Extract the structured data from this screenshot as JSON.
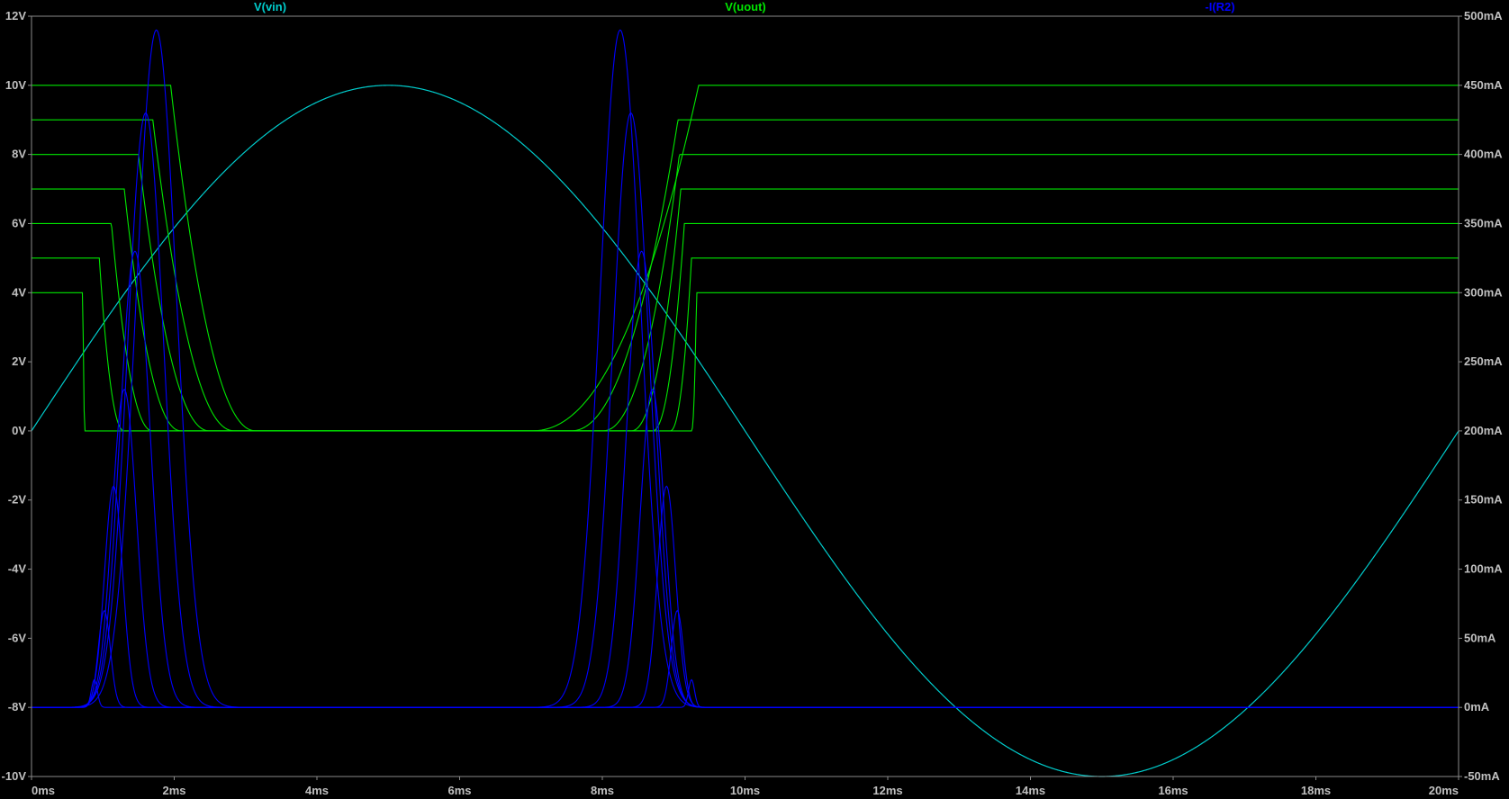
{
  "colors": {
    "background": "#000000",
    "frame": "#8a8a8a",
    "vin": "#00cccc",
    "vout": "#00e600",
    "ir2": "#0000ff",
    "label": "#c0c0c0"
  },
  "chart_data": {
    "type": "line",
    "title": "",
    "x_axis": {
      "range": [
        0,
        20
      ],
      "unit": "ms",
      "ticks": [
        0,
        2,
        4,
        6,
        8,
        10,
        12,
        14,
        16,
        18,
        20
      ],
      "tick_labels": [
        "0ms",
        "2ms",
        "4ms",
        "6ms",
        "8ms",
        "10ms",
        "12ms",
        "14ms",
        "16ms",
        "18ms",
        "20ms"
      ]
    },
    "y_left": {
      "range": [
        -10,
        12
      ],
      "unit": "V",
      "ticks": [
        12,
        10,
        8,
        6,
        4,
        2,
        0,
        -2,
        -4,
        -6,
        -8,
        -10
      ],
      "tick_labels": [
        "12V",
        "10V",
        "8V",
        "6V",
        "4V",
        "2V",
        "0V",
        "-2V",
        "-4V",
        "-6V",
        "-8V",
        "-10V"
      ]
    },
    "y_right": {
      "range": [
        -50,
        500
      ],
      "unit": "mA",
      "ticks": [
        500,
        450,
        400,
        350,
        300,
        250,
        200,
        150,
        100,
        50,
        0,
        -50
      ],
      "tick_labels": [
        "500mA",
        "450mA",
        "400mA",
        "350mA",
        "300mA",
        "250mA",
        "200mA",
        "150mA",
        "100mA",
        "50mA",
        "0mA",
        "-50mA"
      ]
    },
    "grid": false,
    "series": [
      {
        "name": "V(vin)",
        "axis": "left",
        "kind": "sine",
        "amplitude": 10,
        "period_ms": 20,
        "color": "#00cccc"
      },
      {
        "name": "V(uout)",
        "axis": "left",
        "kind": "stepped_family",
        "levels": [
          4,
          5,
          6,
          7,
          8,
          9,
          10
        ],
        "fall_start_ms": [
          0.72,
          0.95,
          1.12,
          1.3,
          1.5,
          1.7,
          1.95
        ],
        "fall_end_ms": [
          0.75,
          1.3,
          1.7,
          2.1,
          2.5,
          2.85,
          3.15
        ],
        "rise_start_ms": [
          9.25,
          8.95,
          8.7,
          8.4,
          8.0,
          7.55,
          7.0
        ],
        "rise_end_ms": [
          9.32,
          9.25,
          9.15,
          9.1,
          9.08,
          9.06,
          9.35
        ],
        "color": "#00e600"
      },
      {
        "name": "-I(R2)",
        "axis": "right",
        "kind": "pulse_family",
        "pulse1_center_ms": [
          0.88,
          1.02,
          1.15,
          1.3,
          1.45,
          1.6,
          1.75
        ],
        "pulse1_peak_mA": [
          20,
          70,
          160,
          230,
          330,
          430,
          490
        ],
        "pulse1_width_ms": [
          0.06,
          0.12,
          0.18,
          0.24,
          0.3,
          0.36,
          0.4
        ],
        "pulse2_center_ms": [
          9.25,
          9.05,
          8.9,
          8.7,
          8.55,
          8.4,
          8.25
        ],
        "pulse2_peak_mA": [
          20,
          70,
          160,
          230,
          330,
          430,
          490
        ],
        "pulse2_width_ms": [
          0.06,
          0.12,
          0.18,
          0.24,
          0.3,
          0.36,
          0.4
        ],
        "color": "#0000ff"
      }
    ],
    "legend": {
      "placement": "top",
      "entries": [
        "V(vin)",
        "V(uout)",
        "-I(R2)"
      ]
    }
  }
}
